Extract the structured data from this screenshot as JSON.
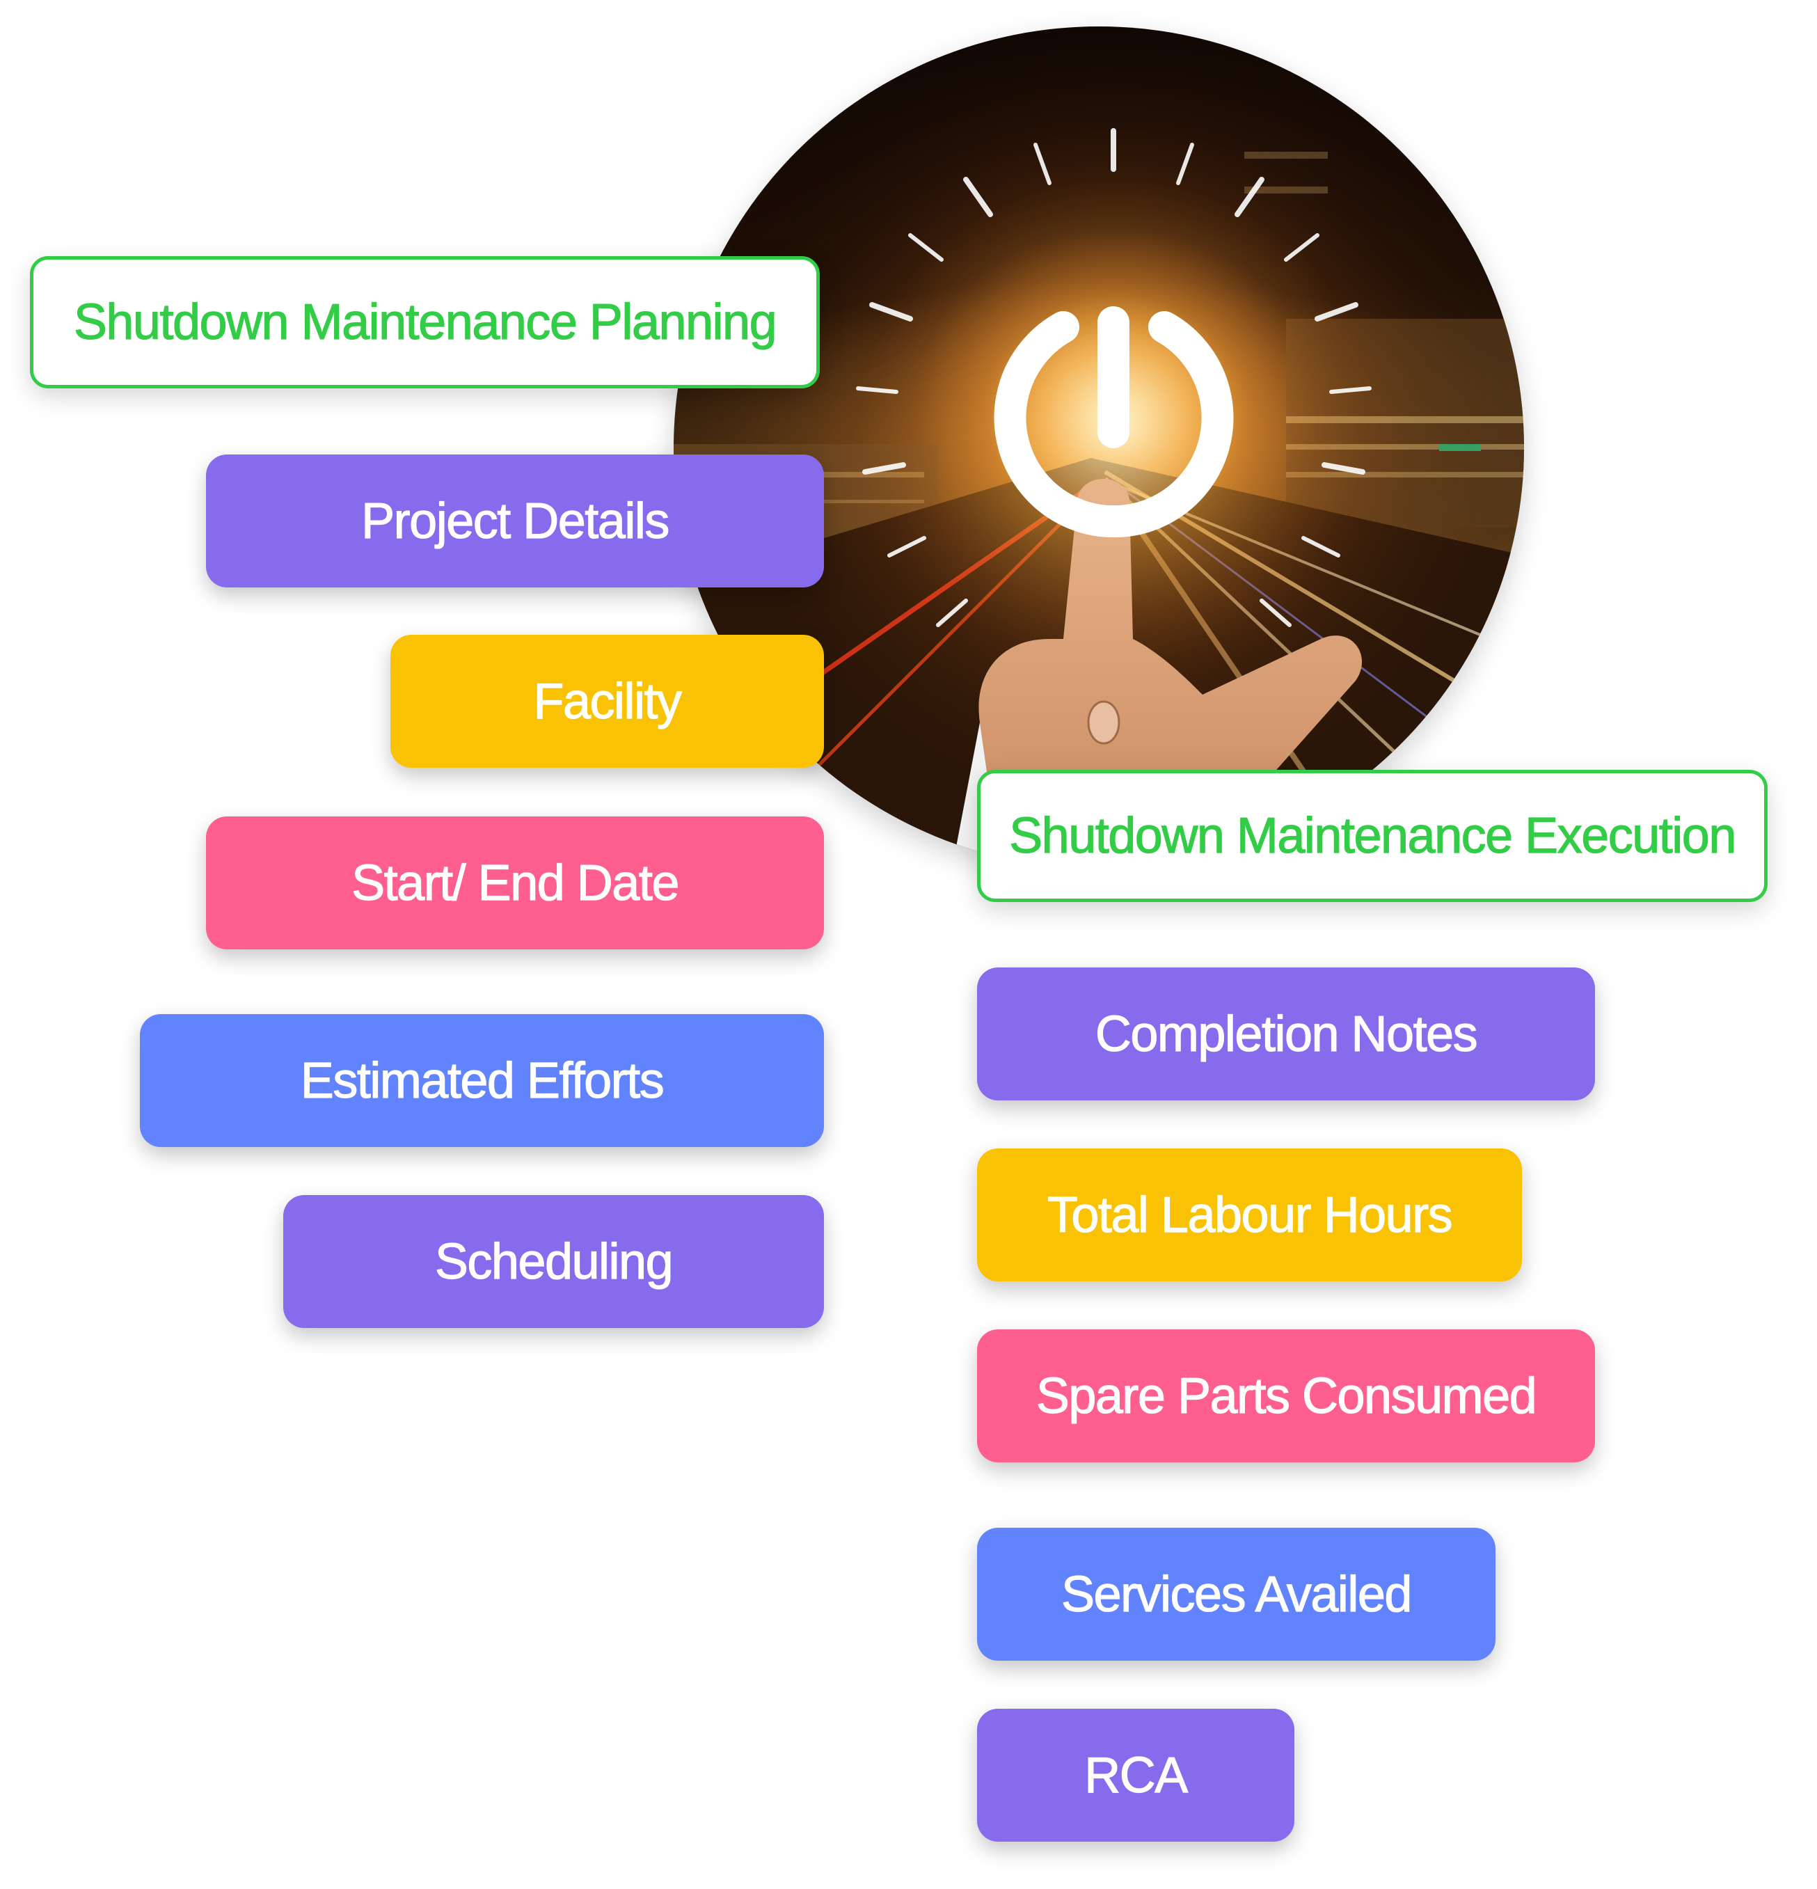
{
  "colors": {
    "header_green": "#33cc47",
    "purple": "#866cec",
    "yellow": "#f9c204",
    "pink": "#ff5f8f",
    "blue": "#6283fe"
  },
  "hero_image": {
    "description": "Finger pressing a glowing power button over a night city with light streaks",
    "icon": "power-icon"
  },
  "planning": {
    "title": "Shutdown Maintenance Planning",
    "items": [
      {
        "label": "Project Details",
        "color": "purple"
      },
      {
        "label": "Facility",
        "color": "yellow"
      },
      {
        "label": "Start/ End Date",
        "color": "pink"
      },
      {
        "label": "Estimated Efforts",
        "color": "blue"
      },
      {
        "label": "Scheduling",
        "color": "purple"
      }
    ]
  },
  "execution": {
    "title": "Shutdown Maintenance Execution",
    "items": [
      {
        "label": "Completion Notes",
        "color": "purple"
      },
      {
        "label": "Total Labour Hours",
        "color": "yellow"
      },
      {
        "label": "Spare Parts Consumed",
        "color": "pink"
      },
      {
        "label": "Services Availed",
        "color": "blue"
      },
      {
        "label": "RCA",
        "color": "purple"
      }
    ]
  }
}
